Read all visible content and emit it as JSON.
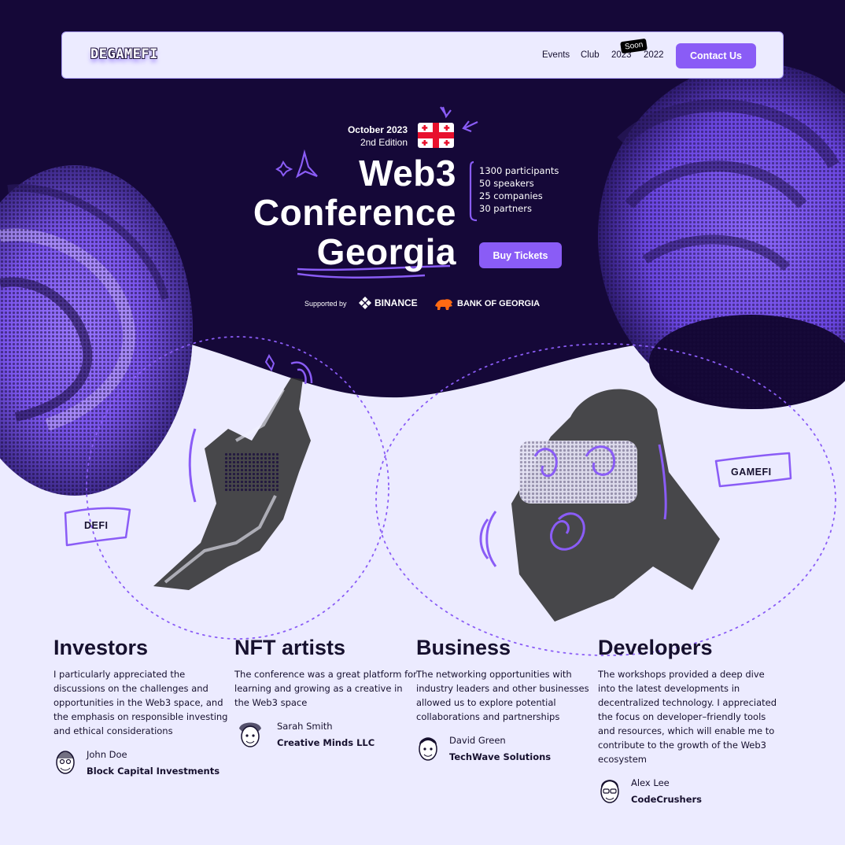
{
  "nav": {
    "logo": "DEGAMEFI",
    "links": [
      "Events",
      "Club",
      "2023",
      "2022"
    ],
    "soon_badge": "Soon",
    "contact_label": "Contact Us"
  },
  "hero": {
    "date": "October 2023",
    "edition": "2nd Edition",
    "flag_icon": "georgia-flag-icon",
    "title_lines": [
      "Web3",
      "Conference",
      "Georgia"
    ],
    "stats": [
      "1300 participants",
      "50 speakers",
      "25 companies",
      "30 partners"
    ],
    "buy_label": "Buy Tickets",
    "supported_by": "Supported by",
    "sponsors": [
      "BINANCE",
      "BANK OF GEORGIA"
    ]
  },
  "tags": {
    "defi": "DEFI",
    "gamefi": "GAMEFI"
  },
  "testimonials": [
    {
      "title": "Investors",
      "quote": "I particularly appreciated the discussions on the challenges and opportunities in the Web3 space, and the emphasis on responsible investing and ethical considerations",
      "name": "John Doe",
      "company": "Block Capital Investments"
    },
    {
      "title": "NFT artists",
      "quote": "The conference was a great platform for learning and growing as a creative in the Web3 space",
      "name": "Sarah Smith",
      "company": "Creative Minds LLC"
    },
    {
      "title": "Business",
      "quote": "The networking opportunities with industry leaders and other businesses allowed us to explore potential collaborations and partnerships",
      "name": "David Green",
      "company": "TechWave Solutions"
    },
    {
      "title": "Developers",
      "quote": "The workshops provided a deep dive into the latest developments in decentralized technology. I appreciated the focus on developer–friendly tools and resources, which will enable me to contribute to the growth of the Web3 ecosystem",
      "name": "Alex Lee",
      "company": "CodeCrushers"
    }
  ],
  "colors": {
    "hero_bg": "#16073f",
    "accent": "#8a5cf6",
    "page_bg": "#ecebff",
    "text": "#16102e"
  }
}
